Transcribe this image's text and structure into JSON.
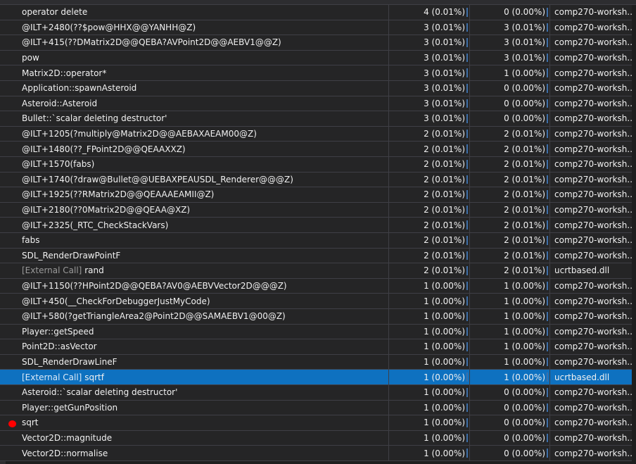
{
  "rows": [
    {
      "name": "operator delete",
      "ext": "",
      "inclusive": "4 (0.01%)",
      "exclusive": "0 (0.00%)",
      "module": "comp270-worksh..."
    },
    {
      "name": "@ILT+2480(??$pow@HHX@@YANHH@Z)",
      "ext": "",
      "inclusive": "3 (0.01%)",
      "exclusive": "3 (0.01%)",
      "module": "comp270-worksh..."
    },
    {
      "name": "@ILT+415(??DMatrix2D@@QEBA?AVPoint2D@@AEBV1@@Z)",
      "ext": "",
      "inclusive": "3 (0.01%)",
      "exclusive": "3 (0.01%)",
      "module": "comp270-worksh..."
    },
    {
      "name": "pow",
      "ext": "",
      "inclusive": "3 (0.01%)",
      "exclusive": "3 (0.01%)",
      "module": "comp270-worksh..."
    },
    {
      "name": "Matrix2D::operator*",
      "ext": "",
      "inclusive": "3 (0.01%)",
      "exclusive": "1 (0.00%)",
      "module": "comp270-worksh..."
    },
    {
      "name": "Application::spawnAsteroid",
      "ext": "",
      "inclusive": "3 (0.01%)",
      "exclusive": "0 (0.00%)",
      "module": "comp270-worksh..."
    },
    {
      "name": "Asteroid::Asteroid",
      "ext": "",
      "inclusive": "3 (0.01%)",
      "exclusive": "0 (0.00%)",
      "module": "comp270-worksh..."
    },
    {
      "name": "Bullet::`scalar deleting destructor'",
      "ext": "",
      "inclusive": "3 (0.01%)",
      "exclusive": "0 (0.00%)",
      "module": "comp270-worksh..."
    },
    {
      "name": "@ILT+1205(?multiply@Matrix2D@@AEBAXAEAM00@Z)",
      "ext": "",
      "inclusive": "2 (0.01%)",
      "exclusive": "2 (0.01%)",
      "module": "comp270-worksh..."
    },
    {
      "name": "@ILT+1480(??_FPoint2D@@QEAAXXZ)",
      "ext": "",
      "inclusive": "2 (0.01%)",
      "exclusive": "2 (0.01%)",
      "module": "comp270-worksh..."
    },
    {
      "name": "@ILT+1570(fabs)",
      "ext": "",
      "inclusive": "2 (0.01%)",
      "exclusive": "2 (0.01%)",
      "module": "comp270-worksh..."
    },
    {
      "name": "@ILT+1740(?draw@Bullet@@UEBAXPEAUSDL_Renderer@@@Z)",
      "ext": "",
      "inclusive": "2 (0.01%)",
      "exclusive": "2 (0.01%)",
      "module": "comp270-worksh..."
    },
    {
      "name": "@ILT+1925(??RMatrix2D@@QEAAAEAMII@Z)",
      "ext": "",
      "inclusive": "2 (0.01%)",
      "exclusive": "2 (0.01%)",
      "module": "comp270-worksh..."
    },
    {
      "name": "@ILT+2180(??0Matrix2D@@QEAA@XZ)",
      "ext": "",
      "inclusive": "2 (0.01%)",
      "exclusive": "2 (0.01%)",
      "module": "comp270-worksh..."
    },
    {
      "name": "@ILT+2325(_RTC_CheckStackVars)",
      "ext": "",
      "inclusive": "2 (0.01%)",
      "exclusive": "2 (0.01%)",
      "module": "comp270-worksh..."
    },
    {
      "name": "fabs",
      "ext": "",
      "inclusive": "2 (0.01%)",
      "exclusive": "2 (0.01%)",
      "module": "comp270-worksh..."
    },
    {
      "name": "SDL_RenderDrawPointF",
      "ext": "",
      "inclusive": "2 (0.01%)",
      "exclusive": "2 (0.01%)",
      "module": "comp270-worksh..."
    },
    {
      "name": "rand",
      "ext": "[External Call]",
      "inclusive": "2 (0.01%)",
      "exclusive": "2 (0.01%)",
      "module": "ucrtbased.dll"
    },
    {
      "name": "@ILT+1150(??HPoint2D@@QEBA?AV0@AEBVVector2D@@@Z)",
      "ext": "",
      "inclusive": "1 (0.00%)",
      "exclusive": "1 (0.00%)",
      "module": "comp270-worksh..."
    },
    {
      "name": "@ILT+450(__CheckForDebuggerJustMyCode)",
      "ext": "",
      "inclusive": "1 (0.00%)",
      "exclusive": "1 (0.00%)",
      "module": "comp270-worksh..."
    },
    {
      "name": "@ILT+580(?getTriangleArea2@Point2D@@SAMAEBV1@00@Z)",
      "ext": "",
      "inclusive": "1 (0.00%)",
      "exclusive": "1 (0.00%)",
      "module": "comp270-worksh..."
    },
    {
      "name": "Player::getSpeed",
      "ext": "",
      "inclusive": "1 (0.00%)",
      "exclusive": "1 (0.00%)",
      "module": "comp270-worksh..."
    },
    {
      "name": "Point2D::asVector",
      "ext": "",
      "inclusive": "1 (0.00%)",
      "exclusive": "1 (0.00%)",
      "module": "comp270-worksh..."
    },
    {
      "name": "SDL_RenderDrawLineF",
      "ext": "",
      "inclusive": "1 (0.00%)",
      "exclusive": "1 (0.00%)",
      "module": "comp270-worksh..."
    },
    {
      "name": "sqrtf",
      "ext": "[External Call]",
      "inclusive": "1 (0.00%)",
      "exclusive": "1 (0.00%)",
      "module": "ucrtbased.dll",
      "selected": true
    },
    {
      "name": "Asteroid::`scalar deleting destructor'",
      "ext": "",
      "inclusive": "1 (0.00%)",
      "exclusive": "0 (0.00%)",
      "module": "comp270-worksh..."
    },
    {
      "name": "Player::getGunPosition",
      "ext": "",
      "inclusive": "1 (0.00%)",
      "exclusive": "0 (0.00%)",
      "module": "comp270-worksh..."
    },
    {
      "name": "sqrt",
      "ext": "",
      "inclusive": "1 (0.00%)",
      "exclusive": "0 (0.00%)",
      "module": "comp270-worksh...",
      "marked": true
    },
    {
      "name": "Vector2D::magnitude",
      "ext": "",
      "inclusive": "1 (0.00%)",
      "exclusive": "0 (0.00%)",
      "module": "comp270-worksh..."
    },
    {
      "name": "Vector2D::normalise",
      "ext": "",
      "inclusive": "1 (0.00%)",
      "exclusive": "0 (0.00%)",
      "module": "comp270-worksh..."
    }
  ],
  "colors": {
    "background": "#1e1e1e",
    "row": "#252526",
    "selected": "#0e71c0",
    "marker": "#ff0000"
  }
}
